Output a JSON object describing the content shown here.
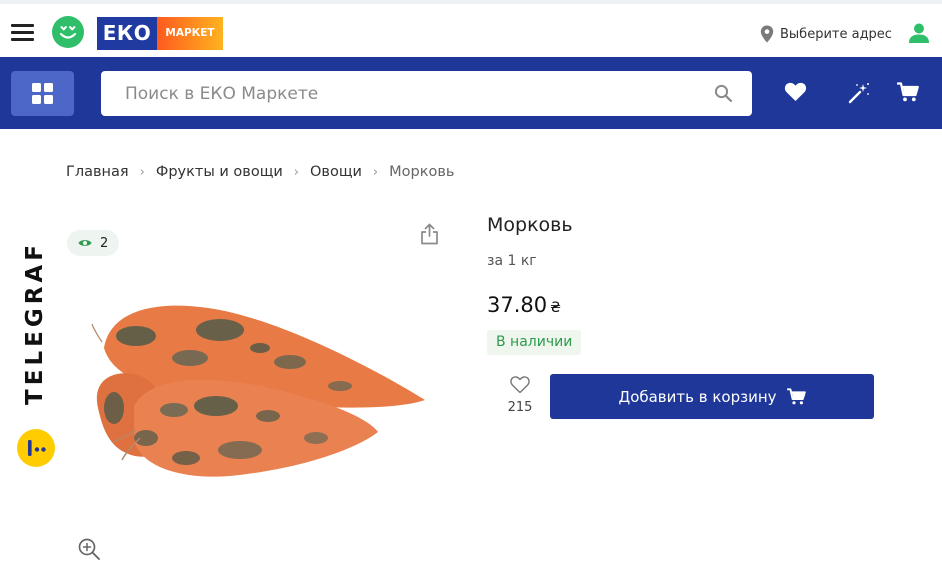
{
  "header": {
    "logo_eko": "ЕКО",
    "logo_market": "МАРКЕТ",
    "address_label": "Выберите адрес"
  },
  "search": {
    "placeholder": "Поиск в ЕКО Маркете"
  },
  "breadcrumb": [
    {
      "label": "Главная"
    },
    {
      "label": "Фрукты и овощи"
    },
    {
      "label": "Овощи"
    },
    {
      "label": "Морковь"
    }
  ],
  "gallery": {
    "views_count": "2",
    "watermark": "TELEGRAF"
  },
  "product": {
    "title": "Морковь",
    "unit": "за 1 кг",
    "price": "37.80",
    "currency": "₴",
    "stock_status": "В наличии",
    "favorites_count": "215",
    "add_to_cart_label": "Добавить в корзину"
  },
  "colors": {
    "brand_blue": "#1e3799",
    "grid_button": "#4c67c7",
    "stock_green": "#2e9a4d",
    "smiley_green": "#2fbf6a"
  }
}
